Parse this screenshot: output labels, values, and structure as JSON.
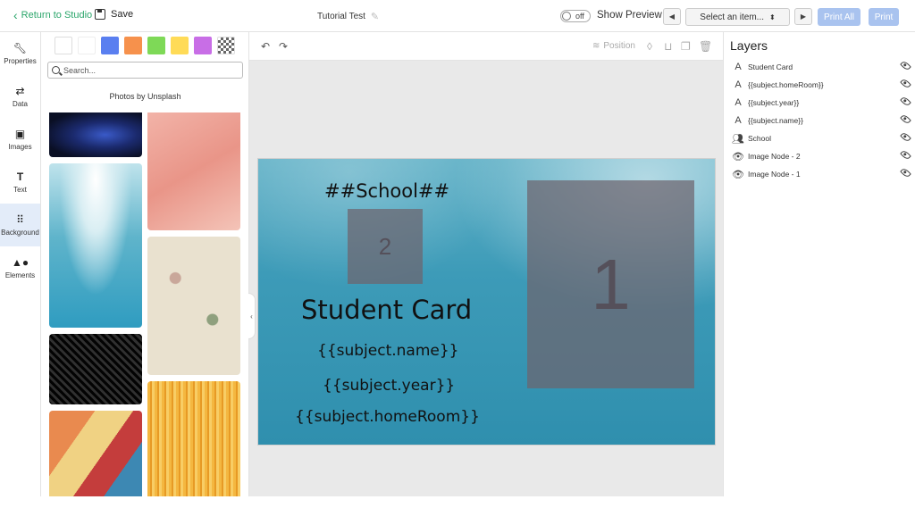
{
  "topbar": {
    "back_label": "Return to Studio",
    "save_label": "Save",
    "doc_title": "Tutorial Test",
    "toggle_label": "off",
    "show_preview_label": "Show Preview",
    "select_placeholder": "Select an item...",
    "print_all_label": "Print All",
    "print_label": "Print"
  },
  "leftnav": {
    "items": [
      {
        "label": "Properties",
        "icon": "wrench-icon",
        "active": false
      },
      {
        "label": "Data",
        "icon": "swap-arrows-icon",
        "active": false
      },
      {
        "label": "Images",
        "icon": "images-icon",
        "active": false
      },
      {
        "label": "Text",
        "icon": "text-t-icon",
        "active": false
      },
      {
        "label": "Background",
        "icon": "grid-dots-icon",
        "active": true
      },
      {
        "label": "Elements",
        "icon": "shapes-icon",
        "active": false
      }
    ]
  },
  "panel": {
    "swatches": [
      "#ffffff",
      "#ffffff",
      "#5a7ff0",
      "#f6914c",
      "#7ed957",
      "#ffdb57",
      "#c86ee6",
      "checker"
    ],
    "search_placeholder": "Search...",
    "photos_label": "Photos by Unsplash"
  },
  "toolbar": {
    "position_label": "Position"
  },
  "card": {
    "school_text": "##School##",
    "title_text": "Student Card",
    "name_text": "{{subject.name}}",
    "year_text": "{{subject.year}}",
    "homeroom_text": "{{subject.homeRoom}}",
    "image_node_2_label": "2",
    "image_node_1_label": "1"
  },
  "layers": {
    "title": "Layers",
    "items": [
      {
        "label": "Student Card",
        "icon": "text-a-icon"
      },
      {
        "label": "{{subject.homeRoom}}",
        "icon": "text-a-icon"
      },
      {
        "label": "{{subject.year}}",
        "icon": "text-a-icon"
      },
      {
        "label": "{{subject.name}}",
        "icon": "text-a-icon"
      },
      {
        "label": "School",
        "icon": "users-icon"
      },
      {
        "label": "Image Node - 2",
        "icon": "image-eye-icon"
      },
      {
        "label": "Image Node - 1",
        "icon": "image-eye-icon"
      }
    ]
  }
}
